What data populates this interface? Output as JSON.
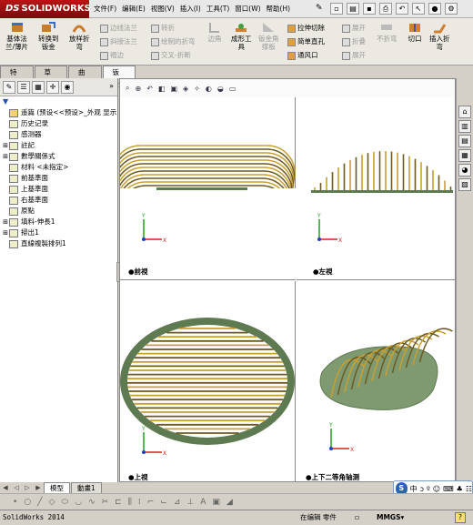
{
  "app": {
    "brand_ds": "DS",
    "brand_name": "SOLIDWORKS"
  },
  "menu": [
    "文件(F)",
    "编辑(E)",
    "视图(V)",
    "插入(I)",
    "工具(T)",
    "窗口(W)",
    "帮助(H)"
  ],
  "ribbon": {
    "base_flange": "基体法\n兰/薄片",
    "convert_sheet": "转换到\n钣金",
    "lofted_bend": "放样折\n弯",
    "edge_flange": "边线法兰",
    "miter_flange": "斜接法兰",
    "hem": "褶边",
    "jog": "转折",
    "sketched_bend": "绘制的折弯",
    "cross_break": "交叉-折断",
    "corners": "边角",
    "forming_tool": "成形工\n具",
    "gusset": "钣金角\n撑板",
    "extruded_cut": "拉伸切除",
    "simple_hole": "简单直孔",
    "vent": "通风口",
    "unfold": "展开",
    "fold": "折叠",
    "flatten": "展开",
    "no_bends": "不折弯",
    "rip": "切口",
    "insert_bends": "插入折\n弯"
  },
  "tabs": [
    "特征",
    "草图",
    "曲面",
    "钣金"
  ],
  "active_tab": "钣金",
  "tree": {
    "filter": "▼",
    "root": "遥篇  (预设<<预设>_外观  显示",
    "nodes": [
      {
        "label": "历史记录",
        "expander": ""
      },
      {
        "label": "感测器",
        "expander": ""
      },
      {
        "label": "註記",
        "expander": "⊞"
      },
      {
        "label": "數學關係式",
        "expander": "⊞"
      },
      {
        "label": "材料 <未指定>",
        "expander": ""
      },
      {
        "label": "前基準面",
        "expander": ""
      },
      {
        "label": "上基準面",
        "expander": ""
      },
      {
        "label": "右基準面",
        "expander": ""
      },
      {
        "label": "原點",
        "expander": ""
      },
      {
        "label": "填料-伸長1",
        "expander": "⊞"
      },
      {
        "label": "掃出1",
        "expander": "⊞"
      },
      {
        "label": "直線複製排列1",
        "expander": ""
      }
    ]
  },
  "views": {
    "front": "●前視",
    "left": "●左視",
    "top": "●上視",
    "iso": "●上下二等角轴测"
  },
  "bottom_tabs": [
    "模型",
    "動畫1"
  ],
  "active_bottom_tab": "模型",
  "ime": [
    "S",
    "中",
    "ↄ",
    "º",
    "☺",
    "⌨",
    "♣",
    "☷"
  ],
  "status": {
    "app": "SolidWorks 2014",
    "mode": "在编辑 零件",
    "units": "MMGS",
    "units_arrow": "▾"
  },
  "colors": {
    "rib": "#c8a030",
    "rib_dark": "#6d5a20",
    "base": "#5e7a50",
    "base_light": "#7f9a70",
    "axis_x": "#d42020",
    "axis_y": "#20a020",
    "axis_z": "#2040c8"
  }
}
